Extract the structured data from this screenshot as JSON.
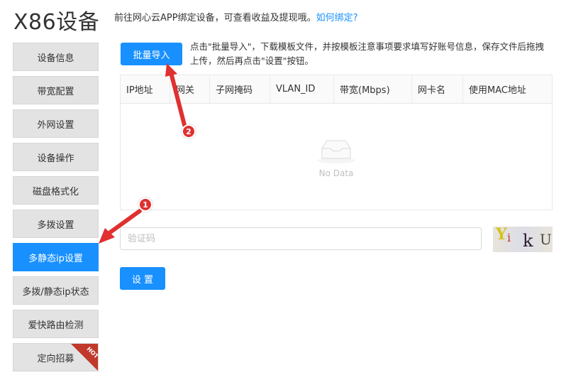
{
  "page": {
    "title": "X86设备",
    "notice_text": "前往网心云APP绑定设备，可查看收益及提现哦。",
    "notice_link": "如何绑定?"
  },
  "sidebar": {
    "items": [
      {
        "label": "设备信息"
      },
      {
        "label": "带宽配置"
      },
      {
        "label": "外网设置"
      },
      {
        "label": "设备操作"
      },
      {
        "label": "磁盘格式化"
      },
      {
        "label": "多拨设置"
      },
      {
        "label": "多静态ip设置",
        "active": true
      },
      {
        "label": "多拨/静态ip状态"
      },
      {
        "label": "爱快路由检测"
      },
      {
        "label": "定向招募",
        "badge": "HOT"
      }
    ]
  },
  "batch_import": {
    "button_label": "批量导入",
    "instruction": "点击\"批量导入\"，下载模板文件，并按模板注意事项要求填写好账号信息，保存文件后拖拽上传，然后再点击\"设置\"按钮。"
  },
  "table": {
    "columns": [
      "IP地址",
      "网关",
      "子网掩码",
      "VLAN_ID",
      "带宽(Mbps)",
      "网卡名",
      "使用MAC地址"
    ],
    "empty_text": "No Data"
  },
  "captcha": {
    "placeholder": "验证码",
    "chars": [
      "Y",
      "i",
      "k",
      "U"
    ]
  },
  "settings": {
    "button_label": "设 置"
  },
  "annotations": {
    "marker_1": "1",
    "marker_2": "2",
    "color": "#e03030"
  },
  "colors": {
    "primary": "#1890ff",
    "hot_badge": "#c0392b"
  }
}
